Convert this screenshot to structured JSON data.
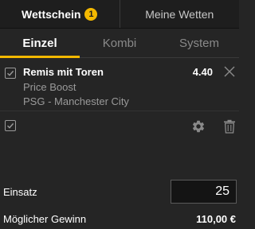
{
  "header": {
    "tabs": [
      {
        "label": "Wettschein",
        "badge": "1"
      },
      {
        "label": "Meine Wetten"
      }
    ]
  },
  "bet_types": {
    "tabs": [
      {
        "label": "Einzel"
      },
      {
        "label": "Kombi"
      },
      {
        "label": "System"
      }
    ]
  },
  "selection": {
    "title": "Remis mit Toren",
    "market": "Price Boost",
    "event": "PSG - Manchester City",
    "odds": "4.40",
    "checked": true
  },
  "actions": {
    "select_all_checked": true,
    "icons": [
      "settings-icon",
      "trash-icon"
    ]
  },
  "stake": {
    "label": "Einsatz",
    "value": "25"
  },
  "winnings": {
    "label": "Möglicher Gewinn",
    "value": "110,00 €"
  },
  "colors": {
    "accent": "#f3b800",
    "background": "#252525",
    "header_background": "#1e1e1e"
  }
}
